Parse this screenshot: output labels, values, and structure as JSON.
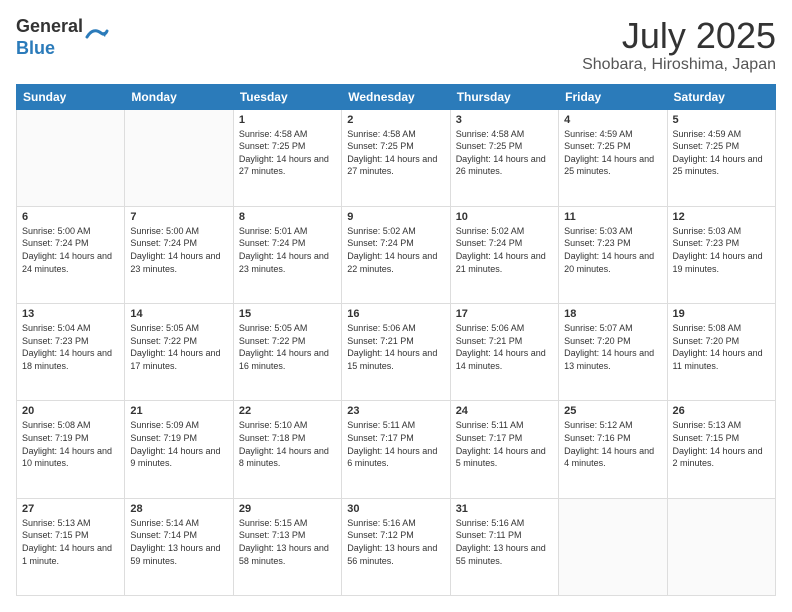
{
  "header": {
    "logo_line1": "General",
    "logo_line2": "Blue",
    "month": "July 2025",
    "location": "Shobara, Hiroshima, Japan"
  },
  "weekdays": [
    "Sunday",
    "Monday",
    "Tuesday",
    "Wednesday",
    "Thursday",
    "Friday",
    "Saturday"
  ],
  "weeks": [
    [
      {
        "day": "",
        "info": ""
      },
      {
        "day": "",
        "info": ""
      },
      {
        "day": "1",
        "info": "Sunrise: 4:58 AM\nSunset: 7:25 PM\nDaylight: 14 hours and 27 minutes."
      },
      {
        "day": "2",
        "info": "Sunrise: 4:58 AM\nSunset: 7:25 PM\nDaylight: 14 hours and 27 minutes."
      },
      {
        "day": "3",
        "info": "Sunrise: 4:58 AM\nSunset: 7:25 PM\nDaylight: 14 hours and 26 minutes."
      },
      {
        "day": "4",
        "info": "Sunrise: 4:59 AM\nSunset: 7:25 PM\nDaylight: 14 hours and 25 minutes."
      },
      {
        "day": "5",
        "info": "Sunrise: 4:59 AM\nSunset: 7:25 PM\nDaylight: 14 hours and 25 minutes."
      }
    ],
    [
      {
        "day": "6",
        "info": "Sunrise: 5:00 AM\nSunset: 7:24 PM\nDaylight: 14 hours and 24 minutes."
      },
      {
        "day": "7",
        "info": "Sunrise: 5:00 AM\nSunset: 7:24 PM\nDaylight: 14 hours and 23 minutes."
      },
      {
        "day": "8",
        "info": "Sunrise: 5:01 AM\nSunset: 7:24 PM\nDaylight: 14 hours and 23 minutes."
      },
      {
        "day": "9",
        "info": "Sunrise: 5:02 AM\nSunset: 7:24 PM\nDaylight: 14 hours and 22 minutes."
      },
      {
        "day": "10",
        "info": "Sunrise: 5:02 AM\nSunset: 7:24 PM\nDaylight: 14 hours and 21 minutes."
      },
      {
        "day": "11",
        "info": "Sunrise: 5:03 AM\nSunset: 7:23 PM\nDaylight: 14 hours and 20 minutes."
      },
      {
        "day": "12",
        "info": "Sunrise: 5:03 AM\nSunset: 7:23 PM\nDaylight: 14 hours and 19 minutes."
      }
    ],
    [
      {
        "day": "13",
        "info": "Sunrise: 5:04 AM\nSunset: 7:23 PM\nDaylight: 14 hours and 18 minutes."
      },
      {
        "day": "14",
        "info": "Sunrise: 5:05 AM\nSunset: 7:22 PM\nDaylight: 14 hours and 17 minutes."
      },
      {
        "day": "15",
        "info": "Sunrise: 5:05 AM\nSunset: 7:22 PM\nDaylight: 14 hours and 16 minutes."
      },
      {
        "day": "16",
        "info": "Sunrise: 5:06 AM\nSunset: 7:21 PM\nDaylight: 14 hours and 15 minutes."
      },
      {
        "day": "17",
        "info": "Sunrise: 5:06 AM\nSunset: 7:21 PM\nDaylight: 14 hours and 14 minutes."
      },
      {
        "day": "18",
        "info": "Sunrise: 5:07 AM\nSunset: 7:20 PM\nDaylight: 14 hours and 13 minutes."
      },
      {
        "day": "19",
        "info": "Sunrise: 5:08 AM\nSunset: 7:20 PM\nDaylight: 14 hours and 11 minutes."
      }
    ],
    [
      {
        "day": "20",
        "info": "Sunrise: 5:08 AM\nSunset: 7:19 PM\nDaylight: 14 hours and 10 minutes."
      },
      {
        "day": "21",
        "info": "Sunrise: 5:09 AM\nSunset: 7:19 PM\nDaylight: 14 hours and 9 minutes."
      },
      {
        "day": "22",
        "info": "Sunrise: 5:10 AM\nSunset: 7:18 PM\nDaylight: 14 hours and 8 minutes."
      },
      {
        "day": "23",
        "info": "Sunrise: 5:11 AM\nSunset: 7:17 PM\nDaylight: 14 hours and 6 minutes."
      },
      {
        "day": "24",
        "info": "Sunrise: 5:11 AM\nSunset: 7:17 PM\nDaylight: 14 hours and 5 minutes."
      },
      {
        "day": "25",
        "info": "Sunrise: 5:12 AM\nSunset: 7:16 PM\nDaylight: 14 hours and 4 minutes."
      },
      {
        "day": "26",
        "info": "Sunrise: 5:13 AM\nSunset: 7:15 PM\nDaylight: 14 hours and 2 minutes."
      }
    ],
    [
      {
        "day": "27",
        "info": "Sunrise: 5:13 AM\nSunset: 7:15 PM\nDaylight: 14 hours and 1 minute."
      },
      {
        "day": "28",
        "info": "Sunrise: 5:14 AM\nSunset: 7:14 PM\nDaylight: 13 hours and 59 minutes."
      },
      {
        "day": "29",
        "info": "Sunrise: 5:15 AM\nSunset: 7:13 PM\nDaylight: 13 hours and 58 minutes."
      },
      {
        "day": "30",
        "info": "Sunrise: 5:16 AM\nSunset: 7:12 PM\nDaylight: 13 hours and 56 minutes."
      },
      {
        "day": "31",
        "info": "Sunrise: 5:16 AM\nSunset: 7:11 PM\nDaylight: 13 hours and 55 minutes."
      },
      {
        "day": "",
        "info": ""
      },
      {
        "day": "",
        "info": ""
      }
    ]
  ]
}
